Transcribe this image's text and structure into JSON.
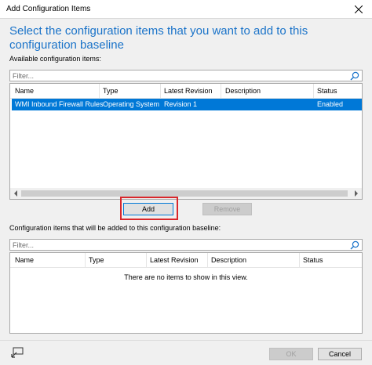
{
  "window": {
    "title": "Add Configuration Items"
  },
  "heading": "Select the configuration items that you want to add to this configuration baseline",
  "available": {
    "label": "Available configuration items:",
    "filter_placeholder": "Filter...",
    "columns": [
      "Name",
      "Type",
      "Latest Revision",
      "Description",
      "Status"
    ],
    "rows": [
      {
        "name": "WMI Inbound Firewall Rules",
        "type": "Operating System",
        "revision": "Revision 1",
        "description": "",
        "status": "Enabled"
      }
    ]
  },
  "buttons": {
    "add": "Add",
    "remove": "Remove",
    "ok": "OK",
    "cancel": "Cancel"
  },
  "selected": {
    "label": "Configuration items that will be added to this configuration baseline:",
    "filter_placeholder": "Filter...",
    "columns": [
      "Name",
      "Type",
      "Latest Revision",
      "Description",
      "Status"
    ],
    "empty_text": "There are no items to show in this view."
  },
  "colors": {
    "accent": "#1a73c9",
    "selection": "#0078d7",
    "highlight": "#d9262b"
  }
}
